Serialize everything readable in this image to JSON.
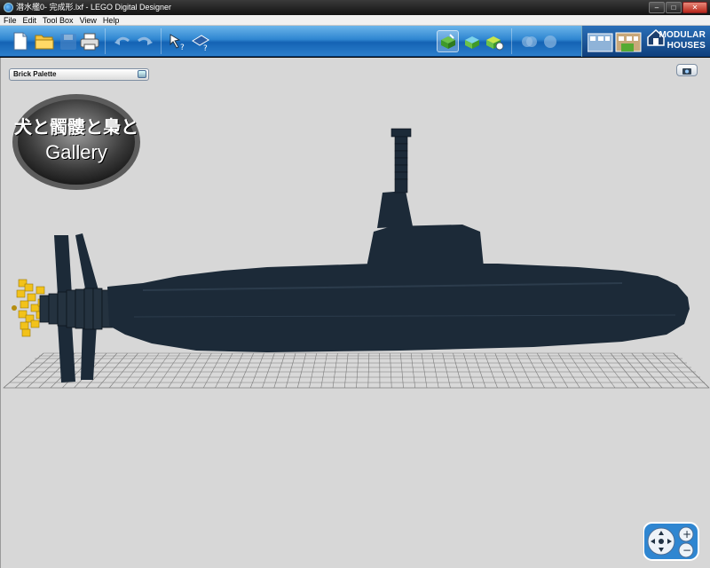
{
  "window": {
    "title": "潜水艦0- 完成形.lxf - LEGO Digital Designer",
    "buttons": {
      "minimize": "–",
      "maximize": "□",
      "close": "✕"
    }
  },
  "menu": [
    "File",
    "Edit",
    "Tool Box",
    "View",
    "Help"
  ],
  "toolbar": {
    "icons": [
      "new-file-icon",
      "open-folder-icon",
      "save-icon",
      "print-icon",
      "undo-icon",
      "redo-icon",
      "select-tool-icon",
      "help-tool-icon",
      "build-mode-icon",
      "view-mode-icon",
      "building-guide-icon",
      "hide-icon",
      "color-icon"
    ],
    "brand_line1": "MODULAR",
    "brand_line2": "HOUSES"
  },
  "palette": {
    "label": "Brick Palette"
  },
  "watermark": {
    "line1": "犬と髑髏と梟と",
    "line2": "Gallery"
  },
  "colors": {
    "accent": "#2f86d1",
    "workspace": "#d7d7d7",
    "submarine": "#1c2a38",
    "propeller": "#f2c21a"
  }
}
